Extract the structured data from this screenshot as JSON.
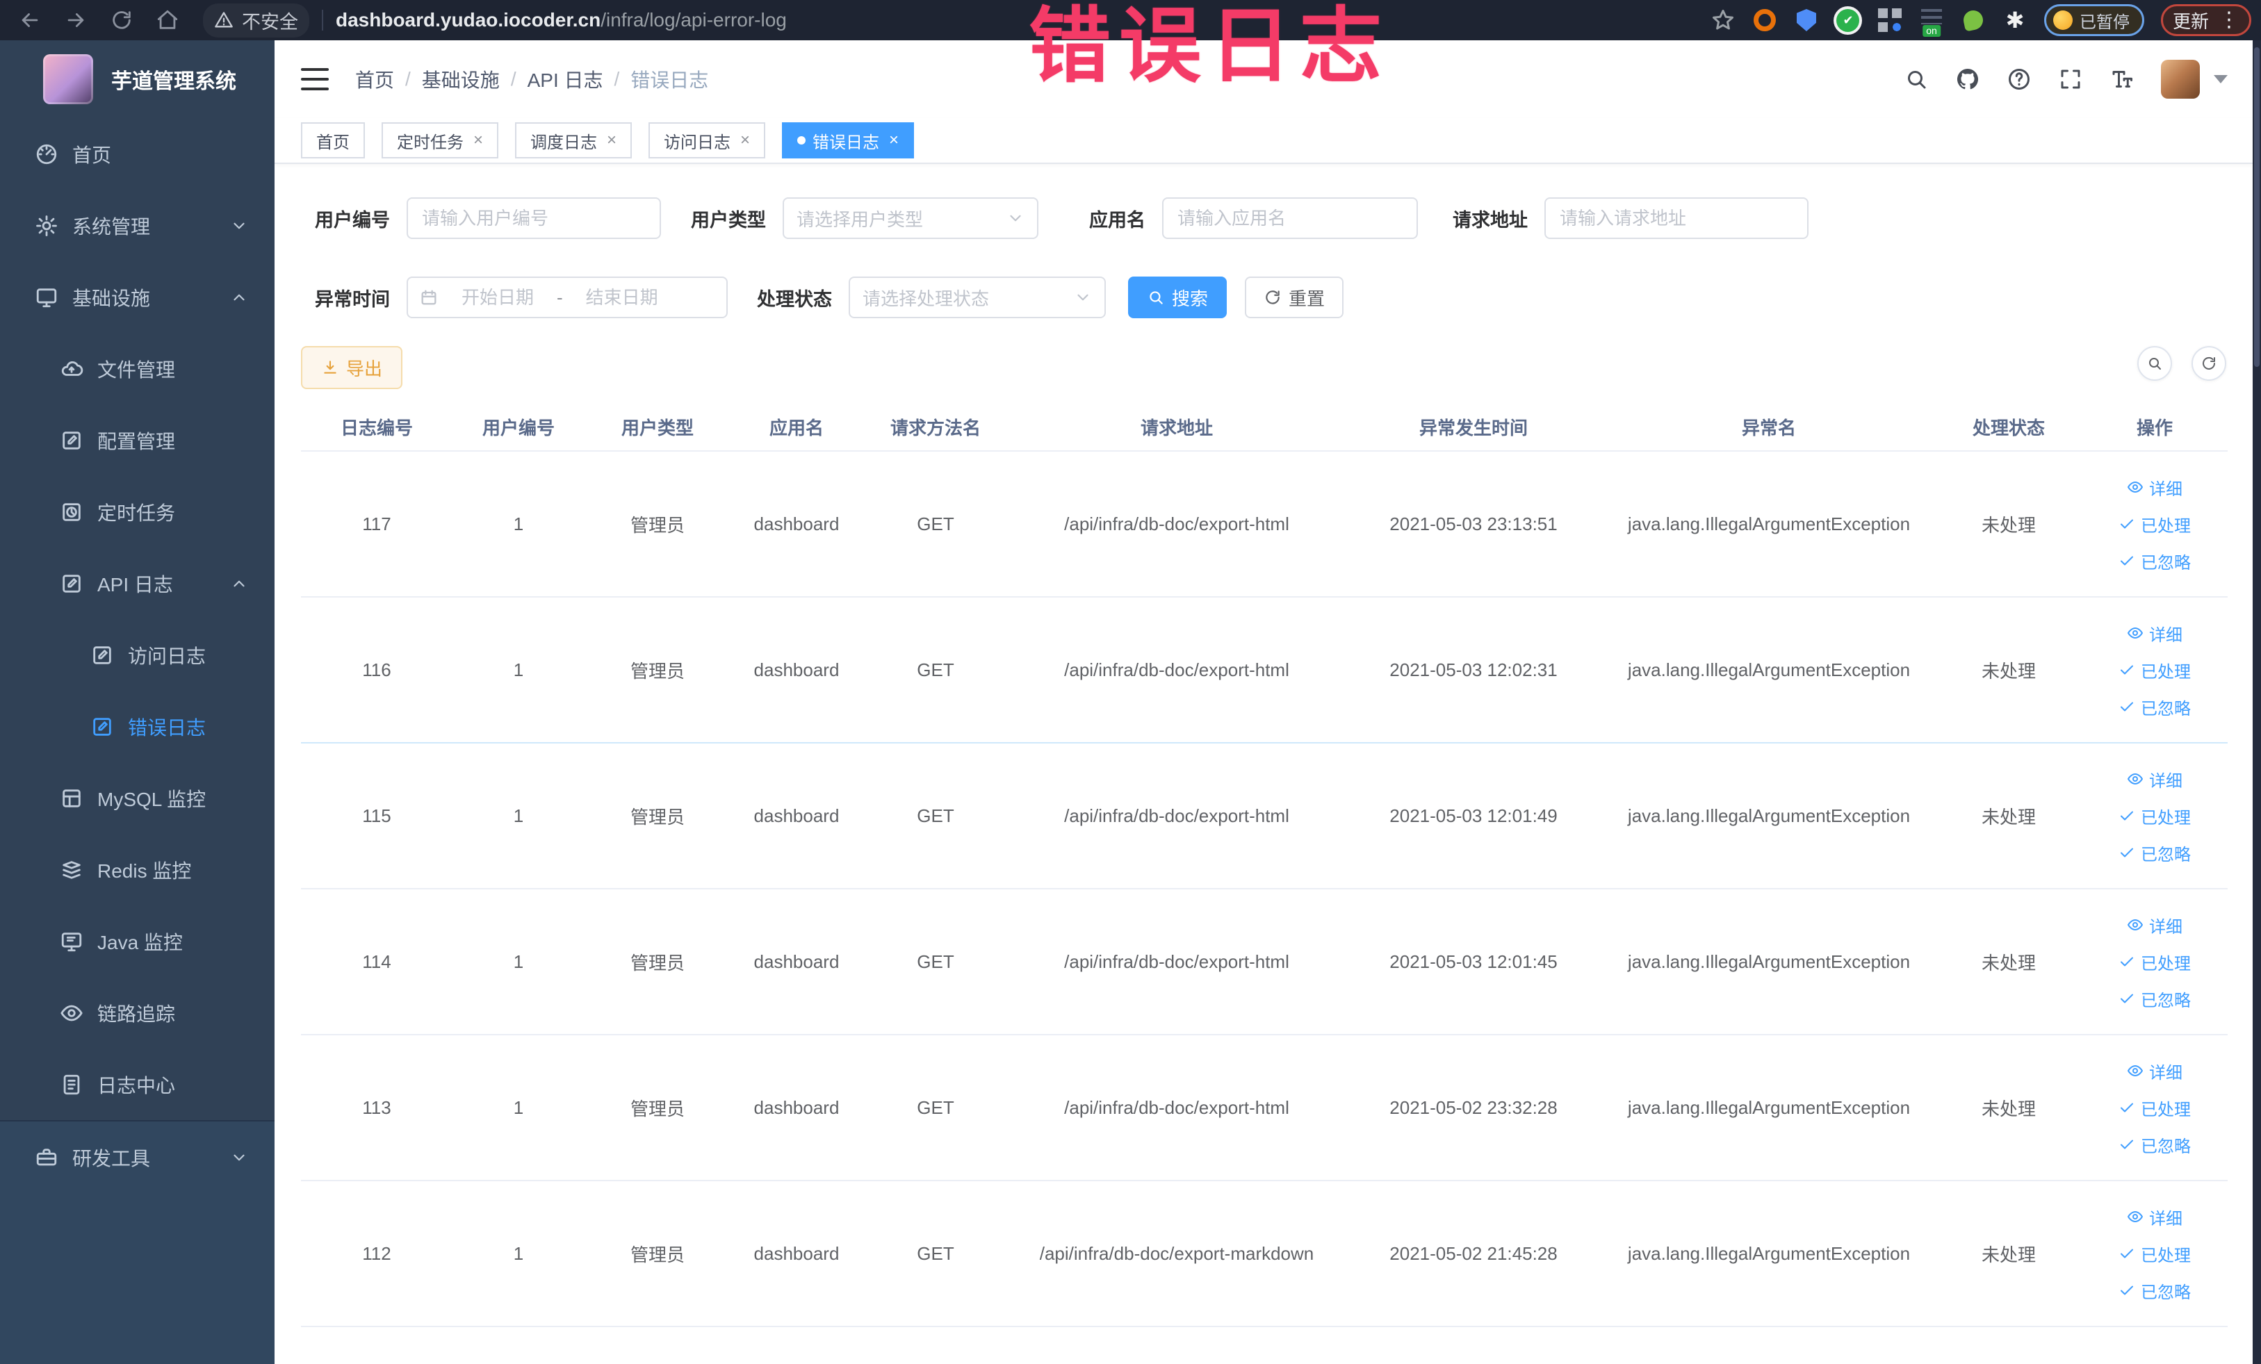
{
  "browser": {
    "security_label": "不安全",
    "url_host": "dashboard.yudao.iocoder.cn",
    "url_path": "/infra/log/api-error-log",
    "nav_icons": [
      "back",
      "forward",
      "reload",
      "home"
    ],
    "extensions": [
      {
        "key": "extension-orange-ring",
        "style": "ring-orange",
        "glyph": ""
      },
      {
        "key": "extension-blue-shield",
        "style": "shield-blue",
        "glyph": ""
      },
      {
        "key": "extension-green-circle",
        "style": "circle-green",
        "glyph": "✔"
      },
      {
        "key": "extension-grid",
        "style": "grid-blue",
        "glyph": ""
      },
      {
        "key": "extension-lines",
        "style": "lines-on",
        "badge": "on",
        "glyph": ""
      },
      {
        "key": "extension-green-sprout",
        "style": "sprout-green",
        "glyph": ""
      },
      {
        "key": "extension-white-star",
        "style": "star-white",
        "glyph": "✱"
      }
    ],
    "paused_chip": {
      "label": "已暂停"
    },
    "update_chip": {
      "label": "更新",
      "menu_dots": "⋮"
    }
  },
  "annotation": {
    "text": "错误日志",
    "color": "#f43b67"
  },
  "sidebar": {
    "title": "芋道管理系统",
    "items": [
      {
        "key": "home",
        "label": "首页",
        "icon": "dashboard",
        "level": 0
      },
      {
        "key": "system",
        "label": "系统管理",
        "icon": "gear",
        "level": 0,
        "arrow": "down"
      },
      {
        "key": "infra",
        "label": "基础设施",
        "icon": "infra",
        "level": 0,
        "arrow": "up"
      },
      {
        "key": "file",
        "label": "文件管理",
        "icon": "cloud",
        "level": 1
      },
      {
        "key": "config",
        "label": "配置管理",
        "icon": "edit",
        "level": 1
      },
      {
        "key": "job",
        "label": "定时任务",
        "icon": "timer",
        "level": 1
      },
      {
        "key": "api-log",
        "label": "API 日志",
        "icon": "api",
        "level": 1,
        "arrow": "up"
      },
      {
        "key": "access-log",
        "label": "访问日志",
        "icon": "log",
        "level": 2
      },
      {
        "key": "error-log",
        "label": "错误日志",
        "icon": "log",
        "level": 2,
        "active": true
      },
      {
        "key": "mysql",
        "label": "MySQL 监控",
        "icon": "mysql",
        "level": 1
      },
      {
        "key": "redis",
        "label": "Redis 监控",
        "icon": "redis",
        "level": 1
      },
      {
        "key": "java",
        "label": "Java 监控",
        "icon": "java",
        "level": 1
      },
      {
        "key": "trace",
        "label": "链路追踪",
        "icon": "eye",
        "level": 1
      },
      {
        "key": "log-center",
        "label": "日志中心",
        "icon": "doc",
        "level": 1
      },
      {
        "key": "dev-tools",
        "label": "研发工具",
        "icon": "toolbox",
        "level": 0,
        "arrow": "down",
        "section": "tools"
      }
    ]
  },
  "header": {
    "breadcrumb": [
      "首页",
      "基础设施",
      "API 日志",
      "错误日志"
    ],
    "separator": "/",
    "icons": [
      "search",
      "github",
      "question",
      "fullscreen",
      "fontsize"
    ]
  },
  "tabs": [
    {
      "key": "home",
      "label": "首页"
    },
    {
      "key": "job",
      "label": "定时任务",
      "closable": true
    },
    {
      "key": "job-log",
      "label": "调度日志",
      "closable": true
    },
    {
      "key": "access-log",
      "label": "访问日志",
      "closable": true
    },
    {
      "key": "error-log",
      "label": "错误日志",
      "closable": true,
      "active": true
    }
  ],
  "close_glyph": "×",
  "filters": {
    "user_id": {
      "label": "用户编号",
      "placeholder": "请输入用户编号"
    },
    "user_type": {
      "label": "用户类型",
      "placeholder": "请选择用户类型"
    },
    "app_name": {
      "label": "应用名",
      "placeholder": "请输入应用名"
    },
    "request_url": {
      "label": "请求地址",
      "placeholder": "请输入请求地址"
    },
    "exception_time": {
      "label": "异常时间",
      "start_placeholder": "开始日期",
      "separator": "-",
      "end_placeholder": "结束日期"
    },
    "process_status": {
      "label": "处理状态",
      "placeholder": "请选择处理状态"
    },
    "search_label": "搜索",
    "reset_label": "重置"
  },
  "toolbar": {
    "export_label": "导出"
  },
  "table": {
    "columns": [
      "日志编号",
      "用户编号",
      "用户类型",
      "应用名",
      "请求方法名",
      "请求地址",
      "异常发生时间",
      "异常名",
      "处理状态",
      "操作"
    ],
    "row_actions": [
      {
        "key": "detail",
        "label": "详细",
        "icon": "eye"
      },
      {
        "key": "processed",
        "label": "已处理",
        "icon": "check"
      },
      {
        "key": "ignored",
        "label": "已忽略",
        "icon": "check"
      }
    ],
    "rows": [
      {
        "id": "117",
        "user_id": "1",
        "user_type": "管理员",
        "app": "dashboard",
        "method": "GET",
        "url": "/api/infra/db-doc/export-html",
        "time": "2021-05-03 23:13:51",
        "exception": "java.lang.IllegalArgumentException",
        "status": "未处理"
      },
      {
        "id": "116",
        "user_id": "1",
        "user_type": "管理员",
        "app": "dashboard",
        "method": "GET",
        "url": "/api/infra/db-doc/export-html",
        "time": "2021-05-03 12:02:31",
        "exception": "java.lang.IllegalArgumentException",
        "status": "未处理"
      },
      {
        "id": "115",
        "user_id": "1",
        "user_type": "管理员",
        "app": "dashboard",
        "method": "GET",
        "url": "/api/infra/db-doc/export-html",
        "time": "2021-05-03 12:01:49",
        "exception": "java.lang.IllegalArgumentException",
        "status": "未处理"
      },
      {
        "id": "114",
        "user_id": "1",
        "user_type": "管理员",
        "app": "dashboard",
        "method": "GET",
        "url": "/api/infra/db-doc/export-html",
        "time": "2021-05-03 12:01:45",
        "exception": "java.lang.IllegalArgumentException",
        "status": "未处理"
      },
      {
        "id": "113",
        "user_id": "1",
        "user_type": "管理员",
        "app": "dashboard",
        "method": "GET",
        "url": "/api/infra/db-doc/export-html",
        "time": "2021-05-02 23:32:28",
        "exception": "java.lang.IllegalArgumentException",
        "status": "未处理"
      },
      {
        "id": "112",
        "user_id": "1",
        "user_type": "管理员",
        "app": "dashboard",
        "method": "GET",
        "url": "/api/infra/db-doc/export-markdown",
        "time": "2021-05-02 21:45:28",
        "exception": "java.lang.IllegalArgumentException",
        "status": "未处理"
      }
    ]
  },
  "colors": {
    "primary": "#409eff",
    "warning": "#e6a23c",
    "annotation": "#f43b67"
  }
}
